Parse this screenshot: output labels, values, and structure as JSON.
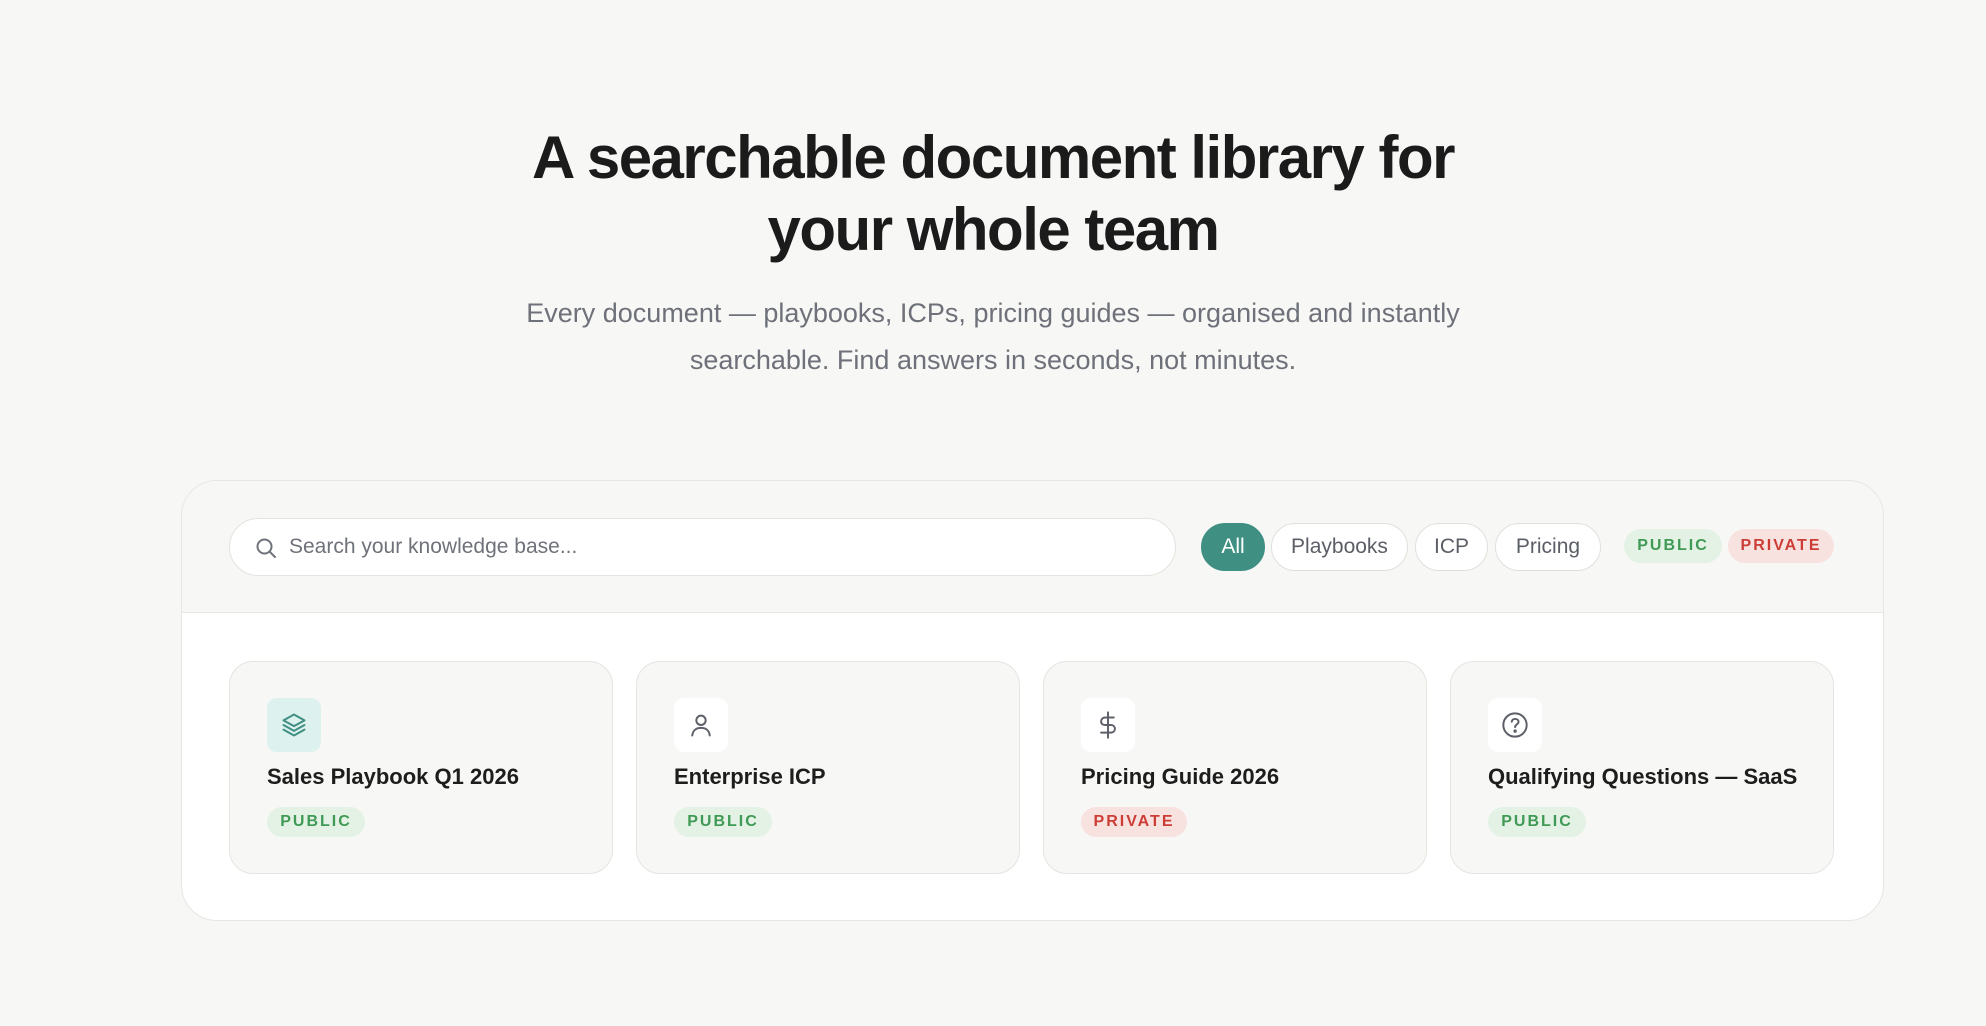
{
  "hero": {
    "title_line1": "A searchable document library for",
    "title_line2": "your whole team",
    "subtitle_line1": "Every document — playbooks, ICPs, pricing guides — organised and instantly",
    "subtitle_line2": "searchable. Find answers in seconds, not minutes."
  },
  "search": {
    "icon": "search-icon",
    "placeholder": "Search your knowledge base...",
    "value": ""
  },
  "filters": [
    {
      "label": "All",
      "active": true
    },
    {
      "label": "Playbooks",
      "active": false
    },
    {
      "label": "ICP",
      "active": false
    },
    {
      "label": "Pricing",
      "active": false
    }
  ],
  "visibility_legend": {
    "public": "PUBLIC",
    "private": "PRIVATE"
  },
  "documents": [
    {
      "title": "Sales Playbook Q1 2026",
      "badge": "PUBLIC",
      "icon": "layers-icon"
    },
    {
      "title": "Enterprise ICP",
      "badge": "PUBLIC",
      "icon": "user-icon"
    },
    {
      "title": "Pricing Guide 2026",
      "badge": "PRIVATE",
      "icon": "dollar-icon"
    },
    {
      "title": "Qualifying Questions — SaaS",
      "badge": "PUBLIC",
      "icon": "help-circle-icon"
    }
  ],
  "colors": {
    "accent": "#3f8f83",
    "public_text": "#3f9a55",
    "public_bg": "#e3f2e5",
    "private_text": "#cc3d35",
    "private_bg": "#f8e2e0",
    "background": "#f7f7f5"
  }
}
